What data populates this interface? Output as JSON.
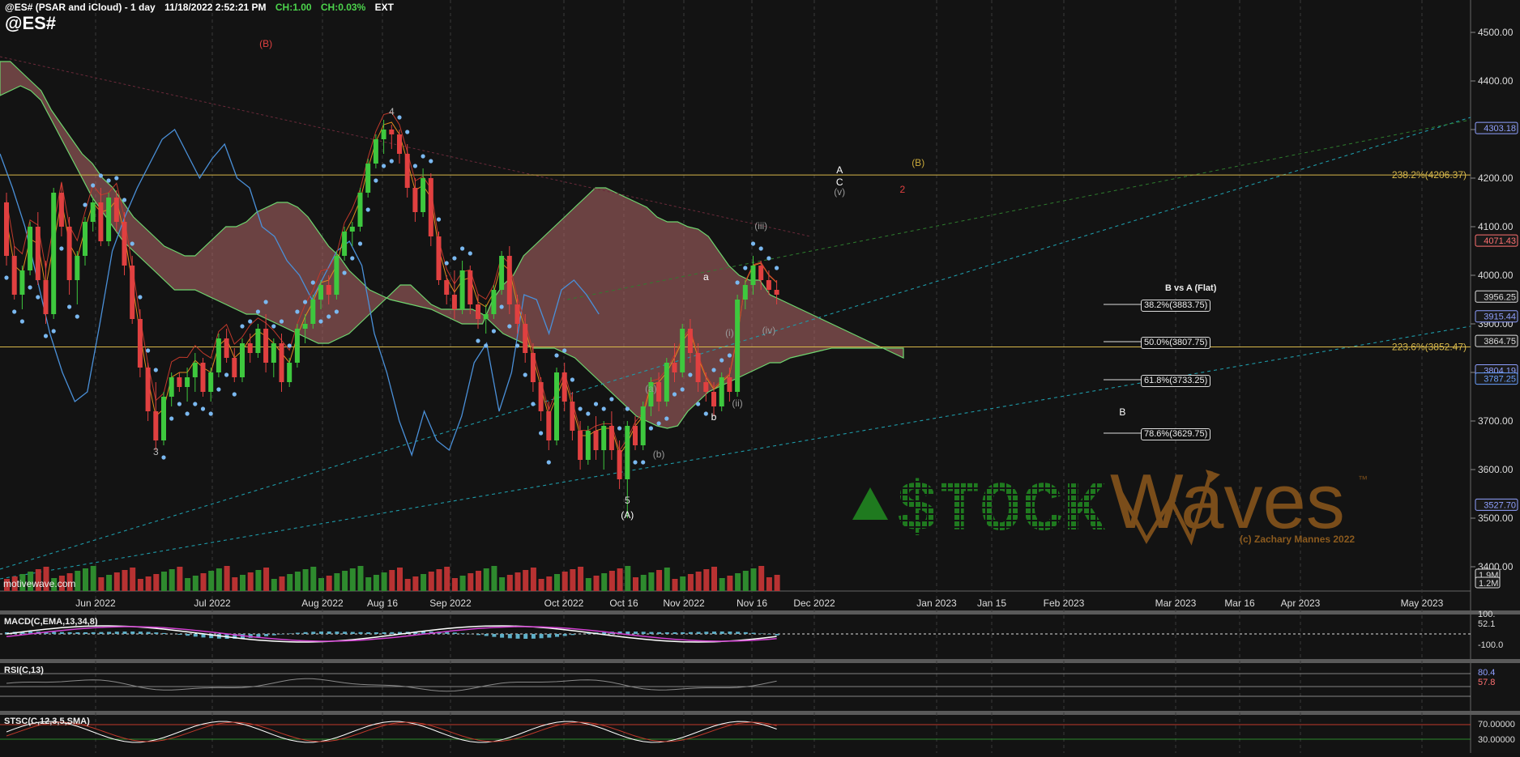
{
  "header": {
    "title": "@ES# (PSAR and iCloud) - 1 day",
    "datetime": "11/18/2022 2:52:21 PM",
    "ch": "CH:1.00",
    "chpct": "CH:0.03%",
    "ext": "EXT",
    "ticker": "@ES#",
    "watermark": "motivewave.com"
  },
  "colors": {
    "background": "#131313",
    "up_candle": "#3ec83e",
    "down_candle": "#e04040",
    "cloud_bull": "#7ab46a",
    "cloud_bear": "#b46a6a",
    "psar": "#7ab8f0",
    "fib_line": "#d8b84a",
    "logo_green": "#1f7a1f",
    "logo_brown": "#7a4d1a"
  },
  "chart_data": {
    "type": "candlestick",
    "price_axis": {
      "min": 3350,
      "max": 4550,
      "ticks": [
        "4500.00",
        "4400.00",
        "4300.00",
        "4200.00",
        "4100.00",
        "4000.00",
        "3900.00",
        "3800.00",
        "3700.00",
        "3600.00",
        "3500.00",
        "3400.00"
      ]
    },
    "price_tags": [
      {
        "label": "4303.18",
        "price": 4303.18,
        "color": "#8fa0ff"
      },
      {
        "label": "4071.43",
        "price": 4071.43,
        "color": "#ff7070"
      },
      {
        "label": "3956.25",
        "price": 3956.25,
        "color": "#dddddd"
      },
      {
        "label": "3915.44",
        "price": 3915.44,
        "color": "#8fa0ff"
      },
      {
        "label": "3864.75",
        "price": 3864.75,
        "color": "#dddddd"
      },
      {
        "label": "3804.19",
        "price": 3804.19,
        "color": "#8fa0ff"
      },
      {
        "label": "3787.25",
        "price": 3787.25,
        "color": "#6aa0ff"
      },
      {
        "label": "3527.70",
        "price": 3527.7,
        "color": "#8fa0ff"
      }
    ],
    "volume_tags": [
      "1.9M",
      "1.2M"
    ],
    "x_axis_labels": [
      "Jun 2022",
      "Jul 2022",
      "Aug 2022",
      "Aug 16",
      "Sep 2022",
      "Oct 2022",
      "Oct 16",
      "Nov 2022",
      "Nov 16",
      "Dec 2022",
      "Jan 2023",
      "Jan 15",
      "Feb 2023",
      "Mar 2023",
      "Mar 16",
      "Apr 2023",
      "May 2023"
    ],
    "fib_levels": [
      {
        "label": "238.2%(4206.37)",
        "price": 4206.37
      },
      {
        "label": "223.6%(3852.47)",
        "price": 3852.47
      }
    ],
    "target_box_title": "B vs A (Flat)",
    "targets": [
      {
        "label": "38.2%(3883.75)",
        "price": 3883.75
      },
      {
        "label": "50.0%(3807.75)",
        "price": 3807.75
      },
      {
        "label": "61.8%(3733.25)",
        "price": 3733.25
      },
      {
        "label": "78.6%(3629.75)",
        "price": 3629.75
      }
    ],
    "wave_labels": [
      {
        "text": "(B)",
        "price": 4470,
        "bar": 33,
        "color": "#e04040"
      },
      {
        "text": "4",
        "price": 4330,
        "bar": 49,
        "color": "#bbbbbb"
      },
      {
        "text": "3",
        "price": 3630,
        "bar": 19,
        "color": "#bbbbbb"
      },
      {
        "text": "5",
        "price": 3530,
        "bar": 79,
        "color": "#dddddd"
      },
      {
        "text": "(A)",
        "price": 3500,
        "bar": 79,
        "color": "#ffffff"
      },
      {
        "text": "(a)",
        "price": 3760,
        "bar": 82,
        "color": "#999999"
      },
      {
        "text": "(b)",
        "price": 3625,
        "bar": 83,
        "color": "#999999"
      },
      {
        "text": "a",
        "price": 3990,
        "bar": 89,
        "color": "#ffffff"
      },
      {
        "text": "b",
        "price": 3702,
        "bar": 90,
        "color": "#ffffff"
      },
      {
        "text": "(iii)",
        "price": 4095,
        "bar": 96,
        "color": "#999999"
      },
      {
        "text": "(i)",
        "price": 3875,
        "bar": 92,
        "color": "#999999"
      },
      {
        "text": "(ii)",
        "price": 3730,
        "bar": 93,
        "color": "#999999"
      },
      {
        "text": "(iv)",
        "price": 3880,
        "bar": 97,
        "color": "#999999"
      },
      {
        "text": "A",
        "price": 4210,
        "bar": 106,
        "color": "#ffffff"
      },
      {
        "text": "C",
        "price": 4185,
        "bar": 106,
        "color": "#ffffff"
      },
      {
        "text": "(v)",
        "price": 4165,
        "bar": 106,
        "color": "#999999"
      },
      {
        "text": "(B)",
        "price": 4225,
        "bar": 116,
        "color": "#c8a83a"
      },
      {
        "text": "2",
        "price": 4170,
        "bar": 114,
        "color": "#e04040"
      },
      {
        "text": "B",
        "price": 3712,
        "bar": 142,
        "color": "#ffffff"
      }
    ],
    "ohlc": [
      [
        4150,
        4170,
        4020,
        4040
      ],
      [
        4040,
        4060,
        3950,
        3960
      ],
      [
        3960,
        4020,
        3930,
        4010
      ],
      [
        4010,
        4110,
        4000,
        4100
      ],
      [
        4100,
        4130,
        3980,
        3990
      ],
      [
        3990,
        4030,
        3900,
        3920
      ],
      [
        3920,
        4180,
        3910,
        4170
      ],
      [
        4170,
        4190,
        4080,
        4100
      ],
      [
        4100,
        4120,
        3960,
        3990
      ],
      [
        3990,
        4050,
        3940,
        4040
      ],
      [
        4040,
        4120,
        4020,
        4110
      ],
      [
        4110,
        4160,
        4090,
        4150
      ],
      [
        4150,
        4180,
        4060,
        4070
      ],
      [
        4070,
        4170,
        4060,
        4160
      ],
      [
        4160,
        4175,
        4090,
        4110
      ],
      [
        4110,
        4130,
        4000,
        4020
      ],
      [
        4020,
        4040,
        3900,
        3910
      ],
      [
        3910,
        3930,
        3790,
        3810
      ],
      [
        3810,
        3820,
        3700,
        3720
      ],
      [
        3720,
        3780,
        3640,
        3660
      ],
      [
        3660,
        3760,
        3650,
        3750
      ],
      [
        3750,
        3800,
        3730,
        3790
      ],
      [
        3790,
        3800,
        3760,
        3770
      ],
      [
        3770,
        3810,
        3740,
        3790
      ],
      [
        3790,
        3840,
        3760,
        3820
      ],
      [
        3820,
        3830,
        3750,
        3760
      ],
      [
        3760,
        3810,
        3740,
        3800
      ],
      [
        3800,
        3880,
        3790,
        3870
      ],
      [
        3870,
        3890,
        3820,
        3830
      ],
      [
        3830,
        3850,
        3780,
        3790
      ],
      [
        3790,
        3870,
        3780,
        3860
      ],
      [
        3860,
        3880,
        3820,
        3840
      ],
      [
        3840,
        3900,
        3830,
        3890
      ],
      [
        3890,
        3920,
        3800,
        3820
      ],
      [
        3820,
        3870,
        3790,
        3860
      ],
      [
        3860,
        3880,
        3760,
        3780
      ],
      [
        3780,
        3830,
        3770,
        3820
      ],
      [
        3820,
        3900,
        3810,
        3890
      ],
      [
        3890,
        3920,
        3860,
        3900
      ],
      [
        3900,
        3960,
        3890,
        3950
      ],
      [
        3950,
        3990,
        3930,
        3980
      ],
      [
        3980,
        4000,
        3940,
        3960
      ],
      [
        3960,
        4050,
        3950,
        4040
      ],
      [
        4040,
        4100,
        4030,
        4090
      ],
      [
        4090,
        4110,
        4060,
        4100
      ],
      [
        4100,
        4180,
        4090,
        4170
      ],
      [
        4170,
        4240,
        4160,
        4230
      ],
      [
        4230,
        4290,
        4220,
        4280
      ],
      [
        4280,
        4320,
        4250,
        4300
      ],
      [
        4300,
        4310,
        4260,
        4290
      ],
      [
        4290,
        4300,
        4230,
        4250
      ],
      [
        4250,
        4270,
        4160,
        4180
      ],
      [
        4180,
        4200,
        4110,
        4130
      ],
      [
        4130,
        4220,
        4120,
        4200
      ],
      [
        4200,
        4210,
        4060,
        4080
      ],
      [
        4080,
        4090,
        3980,
        3990
      ],
      [
        3990,
        4000,
        3940,
        3960
      ],
      [
        3960,
        4010,
        3910,
        3930
      ],
      [
        3930,
        4030,
        3920,
        4010
      ],
      [
        4010,
        4020,
        3920,
        3940
      ],
      [
        3940,
        3960,
        3890,
        3910
      ],
      [
        3910,
        3940,
        3880,
        3920
      ],
      [
        3920,
        3980,
        3910,
        3970
      ],
      [
        3970,
        4050,
        3960,
        4040
      ],
      [
        4040,
        4060,
        3920,
        3940
      ],
      [
        3940,
        3960,
        3880,
        3900
      ],
      [
        3900,
        3920,
        3820,
        3840
      ],
      [
        3840,
        3860,
        3760,
        3780
      ],
      [
        3780,
        3790,
        3700,
        3720
      ],
      [
        3720,
        3740,
        3640,
        3660
      ],
      [
        3660,
        3810,
        3650,
        3800
      ],
      [
        3800,
        3820,
        3720,
        3740
      ],
      [
        3740,
        3760,
        3660,
        3680
      ],
      [
        3680,
        3700,
        3600,
        3620
      ],
      [
        3620,
        3690,
        3610,
        3680
      ],
      [
        3680,
        3710,
        3620,
        3640
      ],
      [
        3640,
        3700,
        3600,
        3690
      ],
      [
        3690,
        3720,
        3620,
        3640
      ],
      [
        3640,
        3660,
        3560,
        3580
      ],
      [
        3580,
        3700,
        3500,
        3690
      ],
      [
        3690,
        3710,
        3640,
        3650
      ],
      [
        3650,
        3740,
        3640,
        3730
      ],
      [
        3730,
        3790,
        3710,
        3780
      ],
      [
        3780,
        3800,
        3720,
        3740
      ],
      [
        3740,
        3830,
        3730,
        3820
      ],
      [
        3820,
        3860,
        3780,
        3800
      ],
      [
        3800,
        3900,
        3790,
        3890
      ],
      [
        3890,
        3910,
        3820,
        3840
      ],
      [
        3840,
        3860,
        3760,
        3780
      ],
      [
        3780,
        3800,
        3740,
        3760
      ],
      [
        3760,
        3780,
        3710,
        3730
      ],
      [
        3730,
        3800,
        3720,
        3790
      ],
      [
        3790,
        3810,
        3740,
        3760
      ],
      [
        3760,
        3960,
        3750,
        3950
      ],
      [
        3950,
        3990,
        3930,
        3980
      ],
      [
        3980,
        4040,
        3960,
        4020
      ],
      [
        4020,
        4030,
        3970,
        3990
      ],
      [
        3990,
        4010,
        3960,
        3970
      ],
      [
        3970,
        3990,
        3940,
        3960
      ]
    ]
  },
  "indicators": {
    "macd": {
      "label": "MACD(C,EMA,13,34,8)",
      "tags": [
        "100.",
        "52.1",
        "-100.0"
      ]
    },
    "rsi": {
      "label": "RSI(C,13)",
      "tags": [
        "80.4",
        "57.8"
      ]
    },
    "stoch": {
      "label": "STSC(C,12,3,5,SMA)",
      "tags": [
        "70.00000",
        "30.00000"
      ]
    }
  },
  "logo": {
    "text_left": "$TOCK",
    "text_right": "Waves",
    "tm": "™",
    "copyright": "(c) Zachary Mannes 2022"
  }
}
